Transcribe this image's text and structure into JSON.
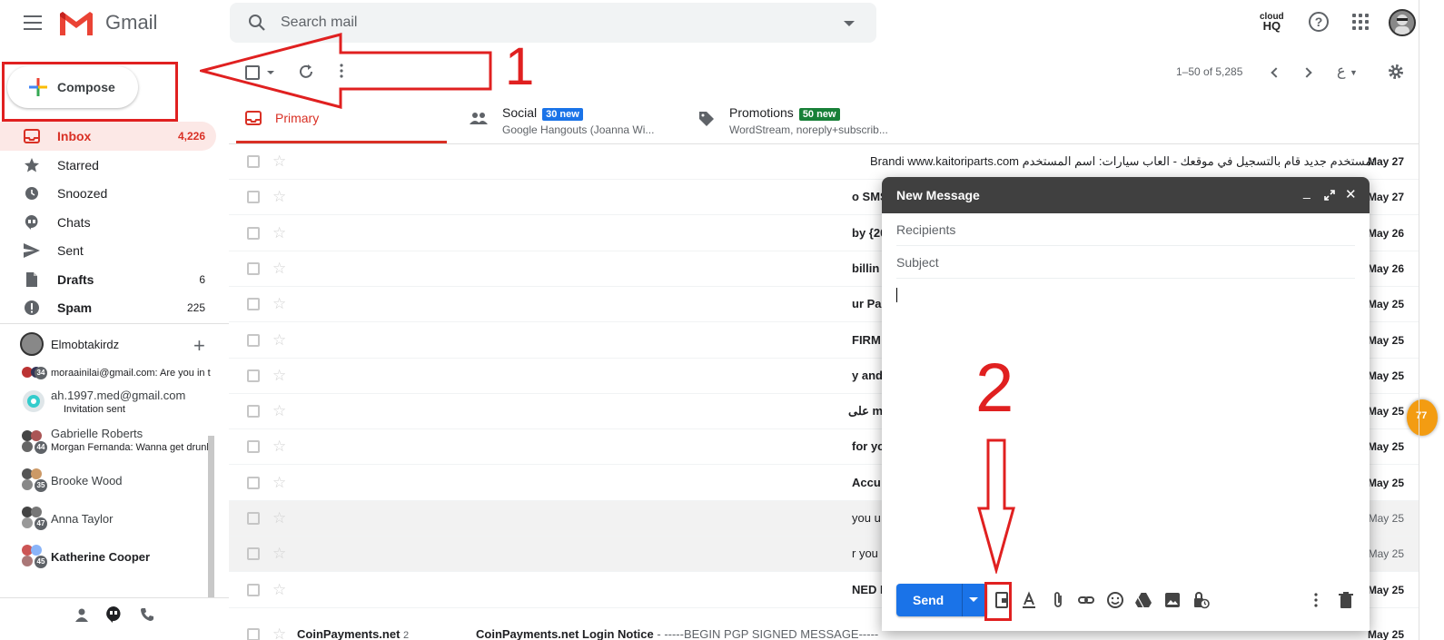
{
  "header": {
    "app_name": "Gmail",
    "search_placeholder": "Search mail",
    "cloudhq_top": "cloud",
    "cloudhq_bottom": "HQ"
  },
  "compose_button": {
    "label": "Compose"
  },
  "annotations": {
    "step1": "1",
    "step2": "2",
    "highlight_color": "#e02020"
  },
  "nav": [
    {
      "label": "Inbox",
      "count": "4,226",
      "icon": "inbox-icon",
      "active": true
    },
    {
      "label": "Starred",
      "count": "",
      "icon": "star-icon"
    },
    {
      "label": "Snoozed",
      "count": "",
      "icon": "clock-icon"
    },
    {
      "label": "Chats",
      "count": "",
      "icon": "chat-icon"
    },
    {
      "label": "Sent",
      "count": "",
      "icon": "send-icon"
    },
    {
      "label": "Drafts",
      "count": "6",
      "icon": "draft-icon"
    },
    {
      "label": "Spam",
      "count": "225",
      "icon": "spam-icon"
    }
  ],
  "hangouts": {
    "user": "Elmobtakirdz",
    "chats": [
      {
        "name": "",
        "snippet": "moraainilai@gmail.com: Are you in t",
        "badge": "34"
      },
      {
        "name": "ah.1997.med@gmail.com",
        "snippet": "Invitation sent",
        "badge": ""
      },
      {
        "name": "Gabrielle Roberts",
        "snippet": "Morgan Fernanda: Wanna get drunk",
        "badge": "44"
      },
      {
        "name": "Brooke Wood",
        "snippet": "",
        "badge": "35"
      },
      {
        "name": "Anna Taylor",
        "snippet": "",
        "badge": "47"
      },
      {
        "name": "Katherine Cooper",
        "snippet": "",
        "badge": "45"
      }
    ]
  },
  "toolbar": {
    "pager": "1–50 of 5,285",
    "lang": "ع"
  },
  "tabs": [
    {
      "label": "Primary",
      "badge": "",
      "sub": "",
      "color": "#d93025"
    },
    {
      "label": "Social",
      "badge": "30 new",
      "sub": "Google Hangouts (Joanna Wi... ",
      "badge_color": "#1a73e8"
    },
    {
      "label": "Promotions",
      "badge": "50 new",
      "sub": "WordStream, noreply+subscrib...",
      "badge_color": "#188038"
    }
  ],
  "rows": [
    {
      "frag": "Brandi www.kaitoriparts.com مستخدم جديد قام بالتسجيل في موقعك - العاب سيارات: اسم المستخدم:",
      "date": "May 27",
      "bold": true
    },
    {
      "frag": "o SMS",
      "date": "May 27",
      "bold": true
    },
    {
      "frag": "by {20",
      "date": "May 26",
      "bold": true
    },
    {
      "frag": "billin",
      "date": "May 26",
      "bold": true
    },
    {
      "frag": "ur Pa",
      "date": "May 25",
      "bold": true
    },
    {
      "frag": "FIRM",
      "date": "May 25",
      "bold": true
    },
    {
      "frag": "y and",
      "date": "May 25",
      "bold": true
    },
    {
      "frag": "على m",
      "date": "May 25",
      "bold": true
    },
    {
      "frag": "for you",
      "date": "May 25",
      "bold": true
    },
    {
      "frag": "Accu",
      "date": "May 25",
      "bold": true
    },
    {
      "frag": "you u",
      "date": "May 25",
      "bold": false
    },
    {
      "frag": "r you",
      "date": "May 25",
      "bold": false
    },
    {
      "frag": "NED M",
      "date": "May 25",
      "bold": true
    }
  ],
  "last_row": {
    "sender": "CoinPayments.net",
    "count": "2",
    "subject": "CoinPayments.net Login Notice",
    "snippet": "- -----BEGIN PGP SIGNED MESSAGE-----",
    "date": "May 25"
  },
  "side_widget": "77",
  "compose_dialog": {
    "title": "New Message",
    "recipients_placeholder": "Recipients",
    "subject_placeholder": "Subject",
    "send_label": "Send"
  }
}
